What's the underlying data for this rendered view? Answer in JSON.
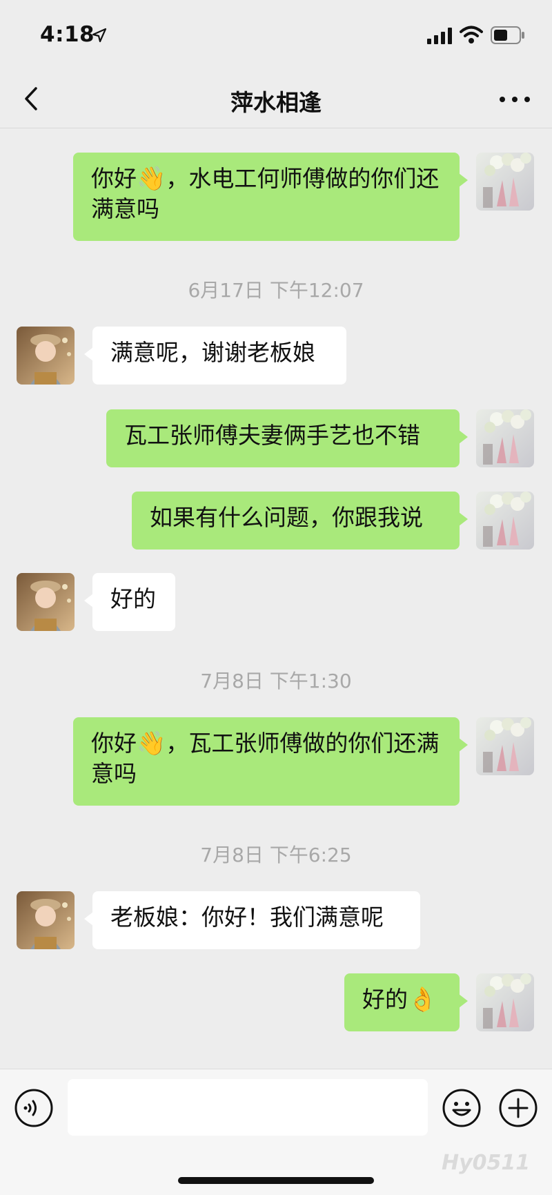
{
  "status_bar": {
    "time": "4:18"
  },
  "header": {
    "title": "萍水相逢"
  },
  "timestamps": [
    "6月17日 下午12:07",
    "7月8日 下午1:30",
    "7月8日 下午6:25"
  ],
  "messages": [
    {
      "from": "me",
      "text": "你好",
      "emoji": "👋",
      "text_after": "，水电工何师傅做的你们还满意吗"
    },
    {
      "from": "them",
      "text": "满意呢，谢谢老板娘"
    },
    {
      "from": "me",
      "text": "瓦工张师傅夫妻俩手艺也不错"
    },
    {
      "from": "me",
      "text": "如果有什么问题，你跟我说"
    },
    {
      "from": "them",
      "text": "好的"
    },
    {
      "from": "me",
      "text": "你好",
      "emoji": "👋",
      "text_after": "，瓦工张师傅做的你们还满意吗"
    },
    {
      "from": "them",
      "text": "老板娘：你好！我们满意呢"
    },
    {
      "from": "me",
      "text": "好的",
      "emoji": "👌",
      "text_after": ""
    }
  ],
  "input": {
    "placeholder": ""
  },
  "watermark": "Hy0511",
  "colors": {
    "me_bubble": "#a9e97b",
    "them_bubble": "#ffffff",
    "background": "#ededed"
  },
  "icons": [
    "back-arrow-icon",
    "more-dots-icon",
    "voice-icon",
    "emoji-icon",
    "plus-icon",
    "signal-icon",
    "wifi-icon",
    "battery-icon",
    "location-arrow-icon"
  ]
}
